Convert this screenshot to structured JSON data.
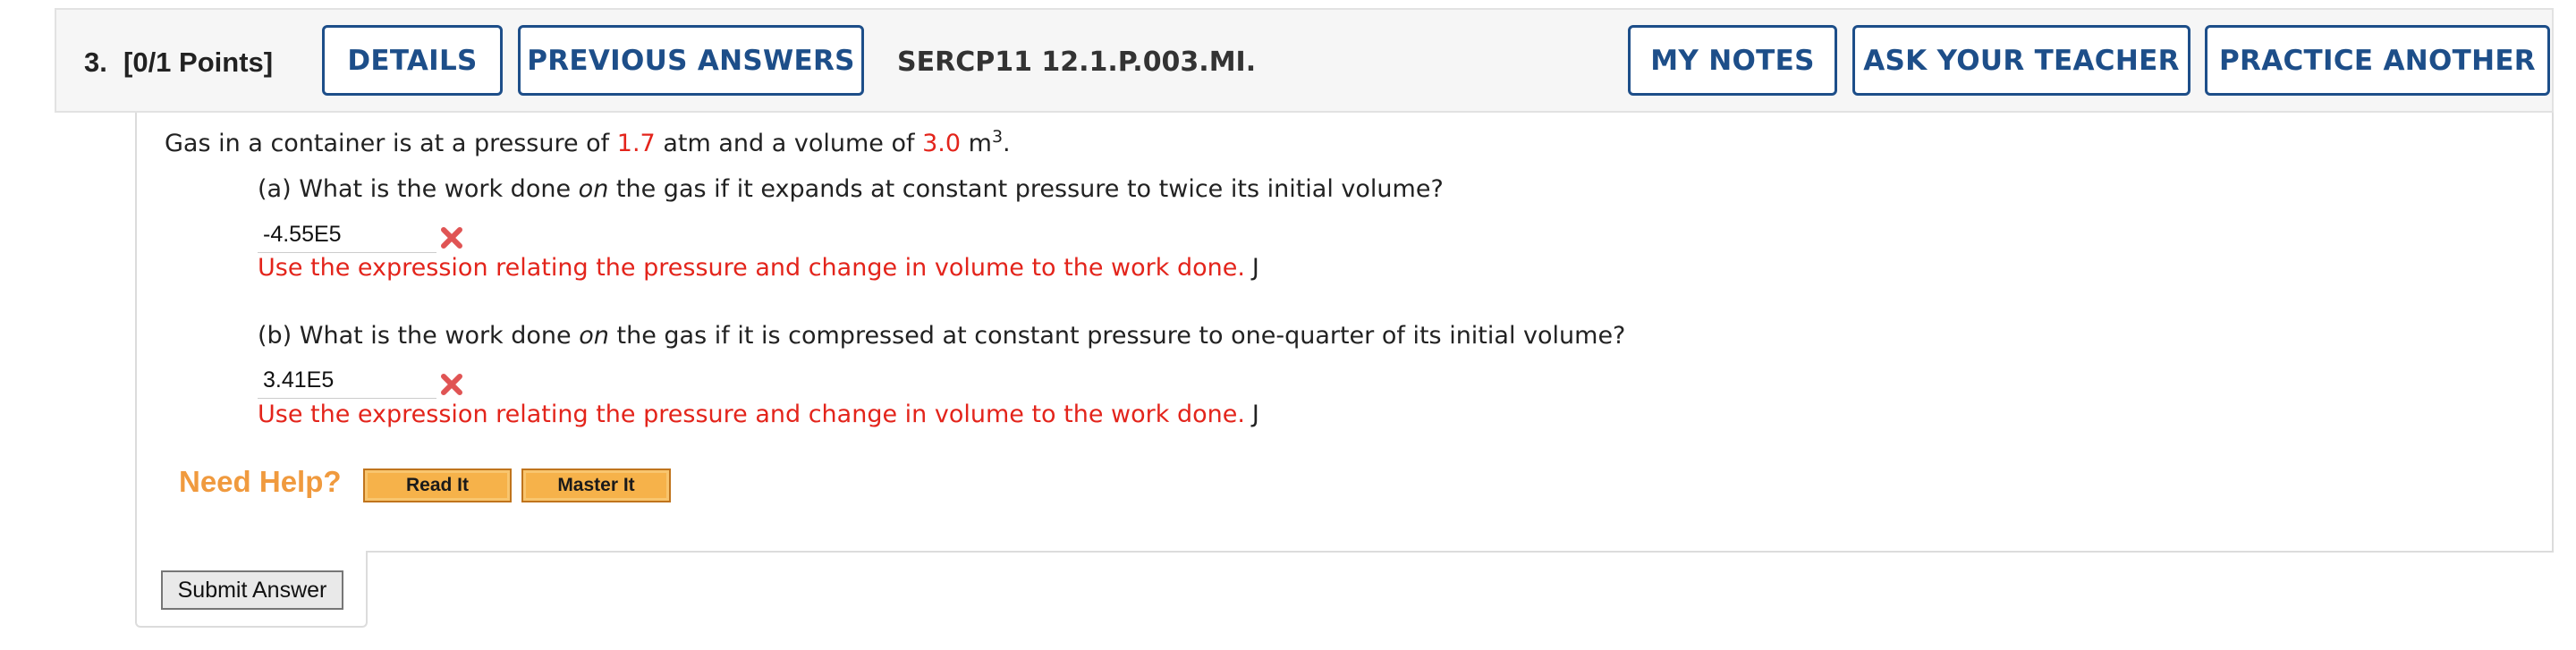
{
  "header": {
    "question_number": "3.",
    "points": "[0/1 Points]",
    "details_label": "DETAILS",
    "previous_answers_label": "PREVIOUS ANSWERS",
    "question_id": "SERCP11 12.1.P.003.MI.",
    "my_notes_label": "MY NOTES",
    "ask_teacher_label": "ASK YOUR TEACHER",
    "practice_another_label": "PRACTICE ANOTHER"
  },
  "question": {
    "stem_prefix": "Gas in a container is at a pressure of",
    "pressure_value": "1.7",
    "stem_middle": "atm and a volume of",
    "volume_value": "3.0",
    "volume_unit": "m",
    "volume_exponent": "3",
    "stem_suffix": ".",
    "parts": [
      {
        "prompt_before": "(a) What is the work done",
        "prompt_emph": "on",
        "prompt_after": "the gas if it expands at constant pressure to twice its initial volume?",
        "answer": "-4.55E5",
        "status": "incorrect",
        "hint": "Use the expression relating the pressure and change in volume to the work done.",
        "unit": "J"
      },
      {
        "prompt_before": "(b) What is the work done",
        "prompt_emph": "on",
        "prompt_after": "the gas if it is compressed at constant pressure to one-quarter of its initial volume?",
        "answer": "3.41E5",
        "status": "incorrect",
        "hint": "Use the expression relating the pressure and change in volume to the work done.",
        "unit": "J"
      }
    ]
  },
  "help": {
    "label": "Need Help?",
    "read_it": "Read It",
    "master_it": "Master It"
  },
  "submit_label": "Submit Answer",
  "colors": {
    "accent_blue": "#1d4e89",
    "error_red": "#e3241b",
    "help_orange": "#f09a3e",
    "help_button": "#f6b24a"
  },
  "icons": {
    "incorrect": "x-mark-icon"
  }
}
